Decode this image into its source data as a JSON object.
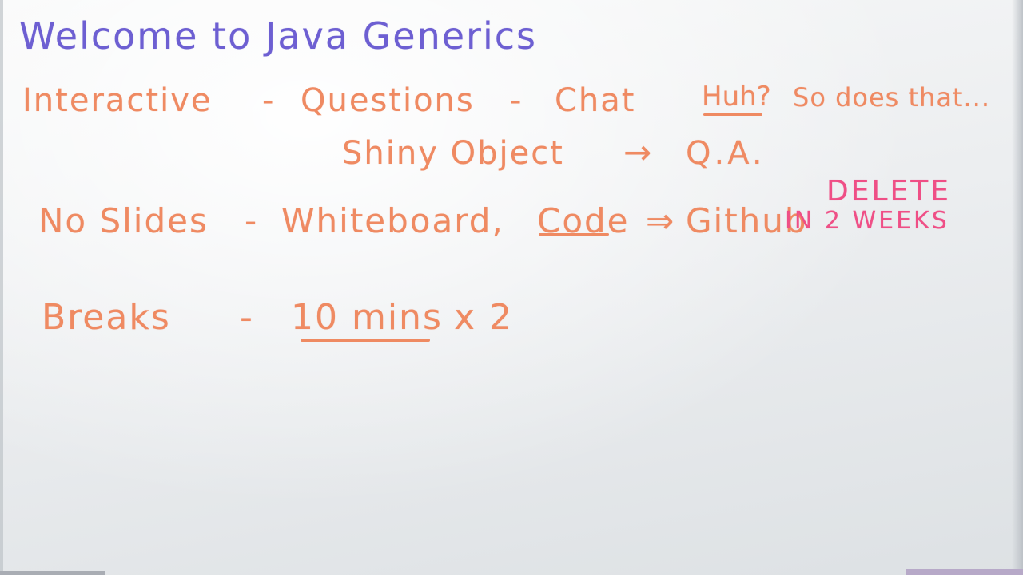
{
  "whiteboard": {
    "title": "Welcome to Java Generics",
    "line1": {
      "interactive": "Interactive",
      "dash1": "-",
      "questions": "Questions",
      "dash2": "-",
      "chat": "Chat",
      "huh": "Huh?",
      "so_does_that": "So does that...",
      "shiny_object": "Shiny Object",
      "arrow": "→",
      "qa": "Q.A."
    },
    "line2": {
      "no_slides": "No Slides",
      "dash": "-",
      "whiteboard_code": "Whiteboard,",
      "code": "Code",
      "implies": "⇒",
      "github": "Github",
      "delete": "DELETE",
      "in_2_weeks": "IN 2 WEEKS"
    },
    "line3": {
      "breaks": "Breaks",
      "dash": "-",
      "ten_mins": "10 mins",
      "times_two": "x 2"
    }
  },
  "colors": {
    "purple_marker": "#6d5fd2",
    "orange_marker": "#ef8a62",
    "pink_marker": "#ef4f86",
    "board": "#f2f4f5"
  }
}
